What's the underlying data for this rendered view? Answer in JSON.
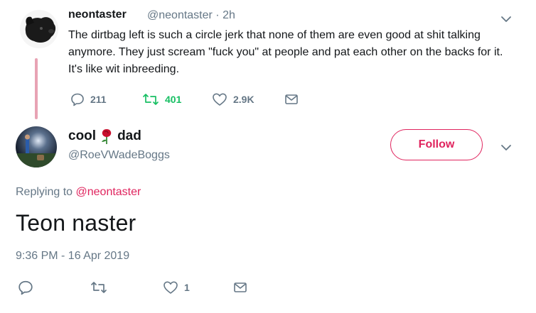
{
  "parent_tweet": {
    "display_name": "neontaster",
    "meta": "@neontaster · 2h",
    "text": "The dirtbag left is such a circle jerk that none of them are even good at shit talking anymore. They just scream \"fuck you\" at people and pat each other on the backs for it. It's like wit inbreeding.",
    "actions": {
      "replies": "211",
      "retweets": "401",
      "likes": "2.9K"
    }
  },
  "reply_tweet": {
    "display_name_part1": "cool",
    "display_name_part2": "dad",
    "handle": "@RoeVWadeBoggs",
    "follow_label": "Follow",
    "replying_prefix": "Replying to",
    "replying_mention": "@neontaster",
    "text": "Teon naster",
    "timestamp": "9:36 PM - 16 Apr 2019",
    "actions": {
      "likes": "1"
    }
  },
  "colors": {
    "accent_pink": "#e0245e",
    "retweet_green": "#17bf63",
    "muted": "#657786",
    "thread_line": "#e8a3b4"
  }
}
